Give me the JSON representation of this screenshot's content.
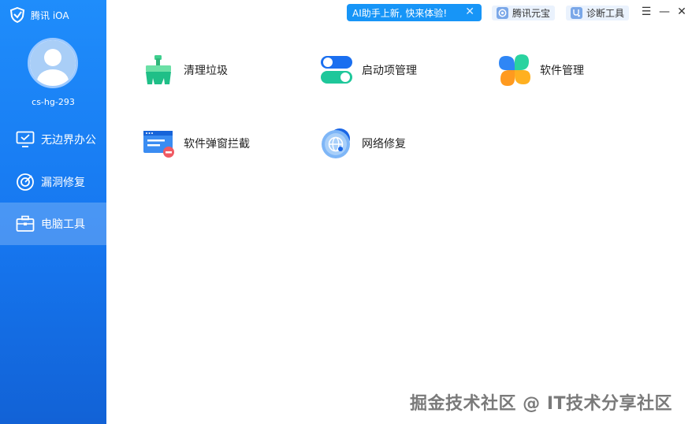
{
  "app": {
    "name": "腾讯 iOA"
  },
  "user": {
    "name": "cs-hg-293"
  },
  "sidebar": {
    "items": [
      {
        "label": "无边界办公",
        "icon": "monitor-check-icon",
        "active": false
      },
      {
        "label": "漏洞修复",
        "icon": "radar-icon",
        "active": false
      },
      {
        "label": "电脑工具",
        "icon": "toolbox-icon",
        "active": true
      }
    ]
  },
  "topbar": {
    "promo": {
      "text": "AI助手上新, 快来体验!",
      "close": "✕"
    },
    "yuanbao_label": "腾讯元宝",
    "diagnose_label": "诊断工具",
    "menu_glyph": "☰",
    "minimize_glyph": "—",
    "close_glyph": "✕"
  },
  "tools": [
    {
      "label": "清理垃圾",
      "icon": "broom-icon"
    },
    {
      "label": "启动项管理",
      "icon": "toggle-icon"
    },
    {
      "label": "软件管理",
      "icon": "clover-icon"
    },
    {
      "label": "软件弹窗拦截",
      "icon": "popup-block-icon"
    },
    {
      "label": "网络修复",
      "icon": "globe-icon"
    }
  ],
  "watermark": "掘金技术社区 @ IT技术分享社区",
  "colors": {
    "sidebar": "#1677f0",
    "accent": "#1795f7"
  }
}
